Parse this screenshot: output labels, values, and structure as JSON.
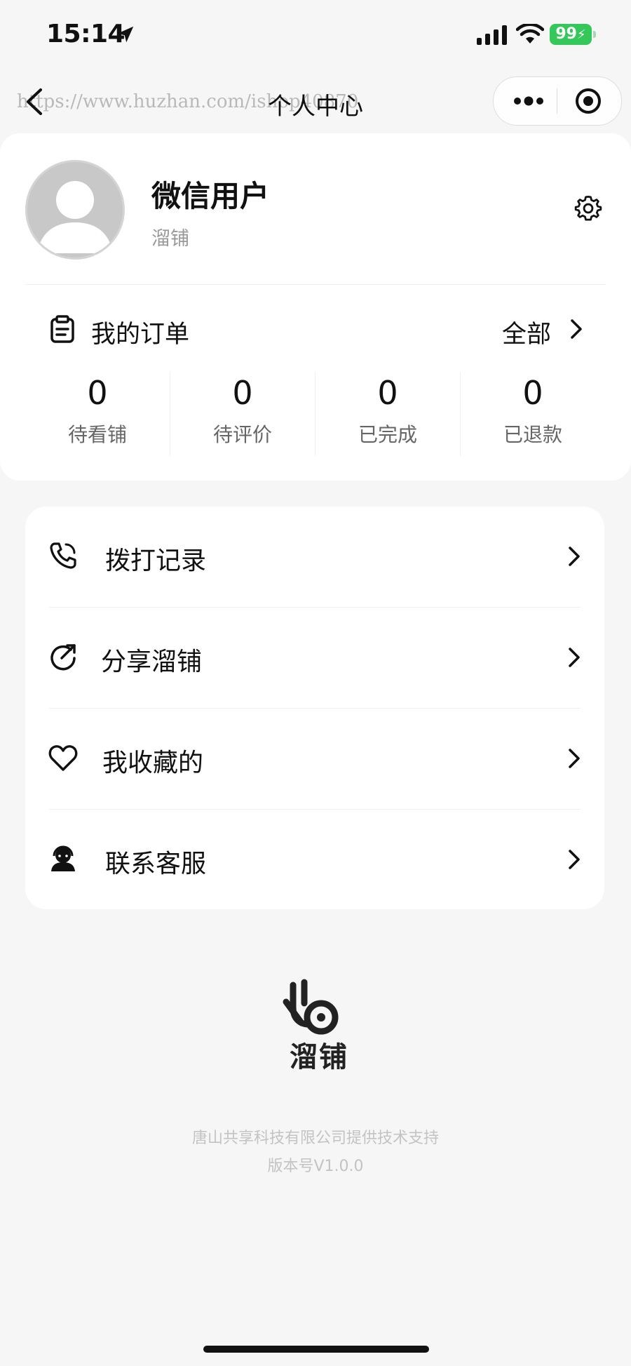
{
  "status_bar": {
    "time": "15:14",
    "battery": "99"
  },
  "nav": {
    "title": "个人中心",
    "watermark": "https://www.huzhan.com/ishop40870"
  },
  "profile": {
    "name": "微信用户",
    "subtitle": "溜铺"
  },
  "orders": {
    "title": "我的订单",
    "all_label": "全部",
    "stats": [
      {
        "count": "0",
        "label": "待看铺"
      },
      {
        "count": "0",
        "label": "待评价"
      },
      {
        "count": "0",
        "label": "已完成"
      },
      {
        "count": "0",
        "label": "已退款"
      }
    ]
  },
  "menu": [
    {
      "label": "拨打记录",
      "icon": "phone-icon"
    },
    {
      "label": "分享溜铺",
      "icon": "share-icon"
    },
    {
      "label": "我收藏的",
      "icon": "heart-icon"
    },
    {
      "label": "联系客服",
      "icon": "customer-service-icon"
    }
  ],
  "footer": {
    "logo_text": "溜铺",
    "support": "唐山共享科技有限公司提供技术支持",
    "version": "版本号V1.0.0"
  },
  "colors": {
    "battery": "#34c759",
    "background": "#f6f6f6",
    "card": "#ffffff"
  }
}
